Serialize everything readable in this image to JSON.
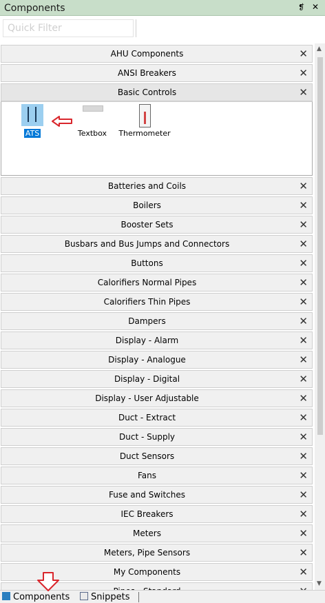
{
  "panel": {
    "title": "Components",
    "pin_glyph": "❡",
    "close_glyph": "✕"
  },
  "filter": {
    "placeholder": "Quick Filter",
    "value": ""
  },
  "groups_before": [
    {
      "label": "AHU Components"
    },
    {
      "label": "ANSI Breakers"
    }
  ],
  "expanded_group": {
    "label": "Basic Controls",
    "items": [
      {
        "label": "ATS",
        "icon": "ats-switch-icon",
        "selected": true
      },
      {
        "label": "Textbox",
        "icon": "textbox-icon",
        "selected": false
      },
      {
        "label": "Thermometer",
        "icon": "thermometer-icon",
        "selected": false
      }
    ]
  },
  "groups_after": [
    {
      "label": "Batteries and Coils"
    },
    {
      "label": "Boilers"
    },
    {
      "label": "Booster Sets"
    },
    {
      "label": "Busbars and Bus Jumps and Connectors"
    },
    {
      "label": "Buttons"
    },
    {
      "label": "Calorifiers Normal Pipes"
    },
    {
      "label": "Calorifiers Thin Pipes"
    },
    {
      "label": "Dampers"
    },
    {
      "label": "Display - Alarm"
    },
    {
      "label": "Display - Analogue"
    },
    {
      "label": "Display - Digital"
    },
    {
      "label": "Display - User Adjustable"
    },
    {
      "label": "Duct - Extract"
    },
    {
      "label": "Duct - Supply"
    },
    {
      "label": "Duct Sensors"
    },
    {
      "label": "Fans"
    },
    {
      "label": "Fuse and Switches"
    },
    {
      "label": "IEC Breakers"
    },
    {
      "label": "Meters"
    },
    {
      "label": "Meters, Pipe Sensors"
    },
    {
      "label": "My Components"
    },
    {
      "label": "Pipes - Standard"
    }
  ],
  "close_glyph": "✕",
  "scrollbar": {
    "up_glyph": "▲",
    "down_glyph": "▼"
  },
  "bottom_tabs": [
    {
      "label": "Components",
      "icon": "components-tab-icon"
    },
    {
      "label": "Snippets",
      "icon": "snippets-tab-icon"
    }
  ],
  "colors": {
    "titlebar": "#c8dec9",
    "selection": "#0078d7",
    "annotation_arrow": "#d9262c"
  }
}
